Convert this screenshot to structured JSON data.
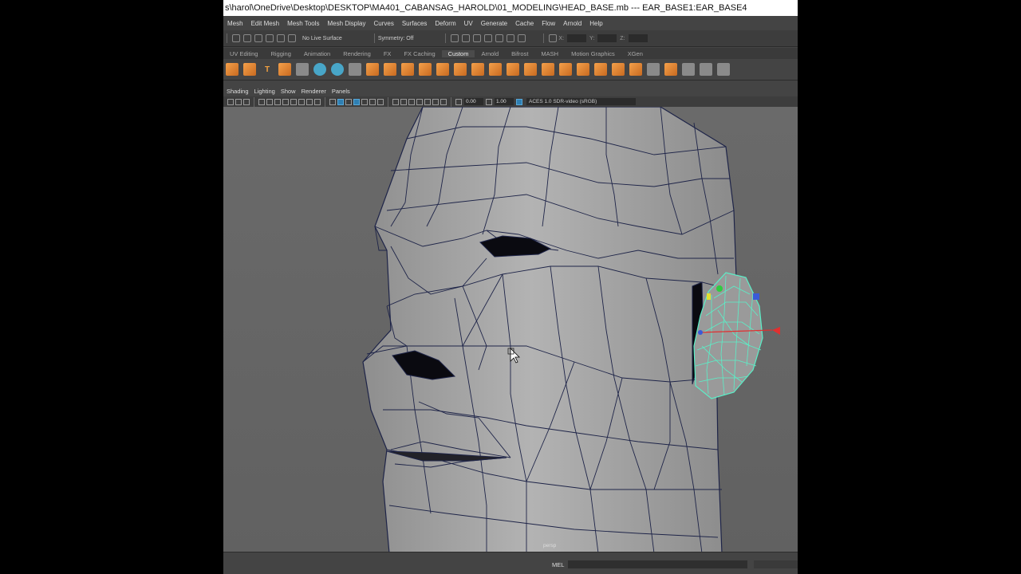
{
  "title": "s\\harol\\OneDrive\\Desktop\\DESKTOP\\MA401_CABANSAG_HAROLD\\01_MODELING\\HEAD_BASE.mb  ---  EAR_BASE1:EAR_BASE4",
  "menubar": [
    "Mesh",
    "Edit Mesh",
    "Mesh Tools",
    "Mesh Display",
    "Curves",
    "Surfaces",
    "Deform",
    "UV",
    "Generate",
    "Cache",
    "Flow",
    "Arnold",
    "Help"
  ],
  "statusline": {
    "live_surface": "No Live Surface",
    "symmetry": "Symmetry: Off",
    "x_label": "X:",
    "y_label": "Y:",
    "z_label": "Z:"
  },
  "shelf_tabs": [
    "UV Editing",
    "Rigging",
    "Animation",
    "Rendering",
    "FX",
    "FX Caching",
    "Custom",
    "Arnold",
    "Bifrost",
    "MASH",
    "Motion Graphics",
    "XGen"
  ],
  "shelf_active_tab": "Custom",
  "panel_menu": [
    "Shading",
    "Lighting",
    "Show",
    "Renderer",
    "Panels"
  ],
  "view_tools": {
    "exposure": "0.00",
    "gamma": "1.00",
    "color_space": "ACES 1.0 SDR-video (sRGB)"
  },
  "viewport": {
    "camera": "persp",
    "selection_wire_color": "#5af0c8",
    "mesh_wire_color": "#1e2448"
  },
  "command_line": {
    "mode": "MEL"
  },
  "colors": {
    "accent_orange": "#f0a040",
    "viewport_bg": "#686868"
  }
}
